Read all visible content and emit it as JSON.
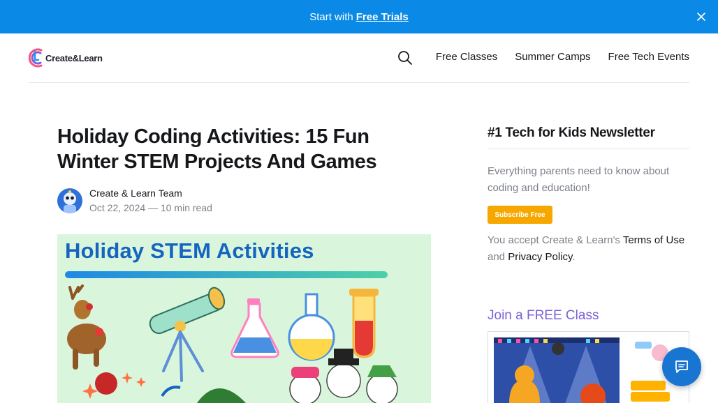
{
  "banner": {
    "prefix": "Start with",
    "link": "Free Trials"
  },
  "brand": {
    "name": "Create&Learn"
  },
  "nav": {
    "items": [
      "Free Classes",
      "Summer Camps",
      "Free Tech Events"
    ]
  },
  "post": {
    "title": "Holiday Coding Activities: 15 Fun Winter STEM Projects And Games",
    "author": "Create & Learn Team",
    "date": "Oct 22, 2024",
    "separator": "—",
    "read_time": "10 min read",
    "hero_title": "Holiday STEM Activities"
  },
  "sidebar": {
    "newsletter_title": "#1 Tech for Kids Newsletter",
    "newsletter_desc": "Everything parents need to know about coding and education!",
    "subscribe_label": "Subscribe Free",
    "terms_prefix": "You accept Create & Learn's",
    "terms_link": "Terms of Use",
    "and": "and",
    "privacy_link": "Privacy Policy",
    "period": ".",
    "join_title": "Join a FREE Class"
  },
  "colors": {
    "banner": "#0a8ae6",
    "subscribe": "#f7a800",
    "join": "#7b61d9",
    "chat": "#1875d2"
  },
  "icons": [
    "close-icon",
    "search-icon",
    "chat-icon"
  ]
}
